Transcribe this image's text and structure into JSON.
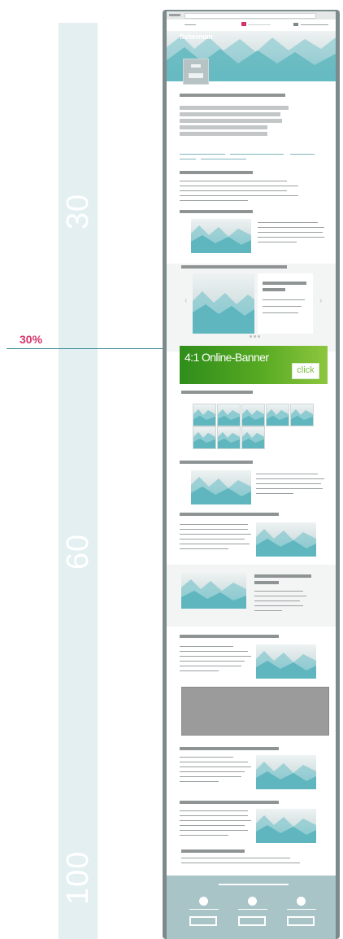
{
  "scale": {
    "labels": [
      "30",
      "60",
      "100"
    ]
  },
  "marker": {
    "label": "30%"
  },
  "page": {
    "logo": "fisherman",
    "banner": {
      "text": "4:1 Online-Banner",
      "button": "click"
    }
  },
  "colors": {
    "marker": "#d6336c",
    "line": "#3a8a97",
    "banner_green": "#57aa22",
    "footer": "#a8c4c7"
  }
}
